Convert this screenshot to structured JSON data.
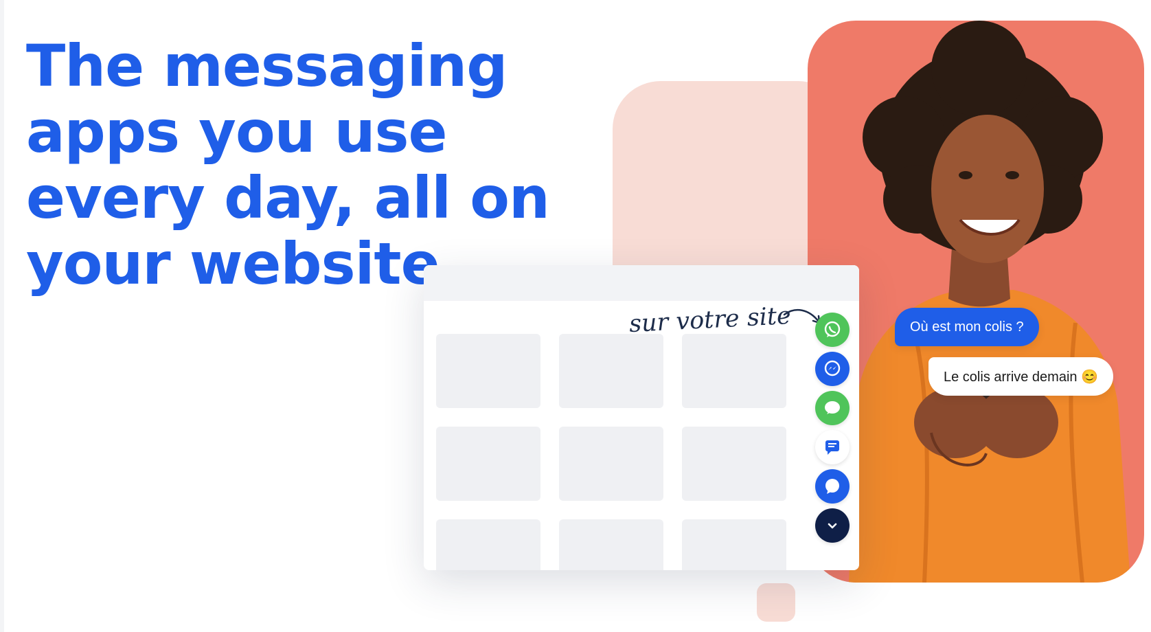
{
  "hero": {
    "headline_lines": [
      "The messaging",
      "apps you use",
      "every day, all on",
      "your website."
    ]
  },
  "widget": {
    "tagline": "sur votre site",
    "apps": [
      {
        "name": "whatsapp-icon",
        "color": "#4fc45a"
      },
      {
        "name": "messenger-icon",
        "color": "#1f5ee8"
      },
      {
        "name": "imessage-icon",
        "color": "#4fc45a"
      },
      {
        "name": "live-chat-icon",
        "color": "#ffffff"
      },
      {
        "name": "signal-icon",
        "color": "#1f5ee8"
      },
      {
        "name": "collapse-chevron-icon",
        "color": "#0f1f47"
      }
    ]
  },
  "chat": {
    "question": "Où est mon colis ?",
    "answer": "Le colis arrive demain 😊"
  },
  "colors": {
    "brand_blue": "#1f5ee8",
    "salmon": "#ef7a68",
    "light_pink": "#f8dcd5",
    "navy": "#0f1f47"
  }
}
